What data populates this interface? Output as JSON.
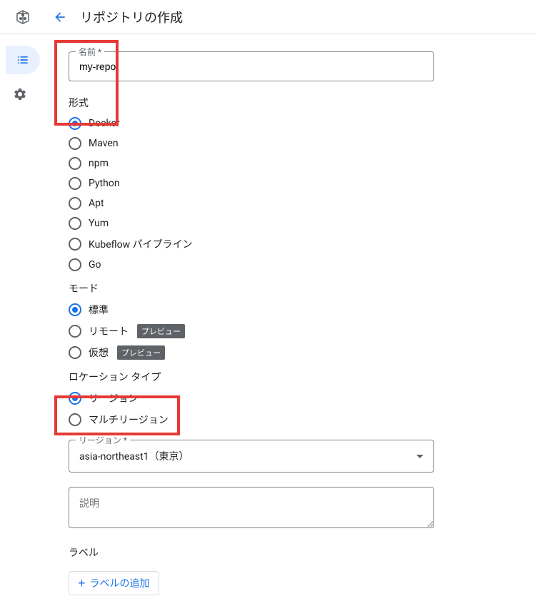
{
  "header": {
    "title": "リポジトリの作成"
  },
  "form": {
    "name": {
      "label": "名前 *",
      "value": "my-repo"
    },
    "format": {
      "label": "形式",
      "options": [
        {
          "label": "Docker",
          "checked": true
        },
        {
          "label": "Maven",
          "checked": false
        },
        {
          "label": "npm",
          "checked": false
        },
        {
          "label": "Python",
          "checked": false
        },
        {
          "label": "Apt",
          "checked": false
        },
        {
          "label": "Yum",
          "checked": false
        },
        {
          "label": "Kubeflow パイプライン",
          "checked": false
        },
        {
          "label": "Go",
          "checked": false
        }
      ]
    },
    "mode": {
      "label": "モード",
      "options": [
        {
          "label": "標準",
          "checked": true,
          "badge": null
        },
        {
          "label": "リモート",
          "checked": false,
          "badge": "プレビュー"
        },
        {
          "label": "仮想",
          "checked": false,
          "badge": "プレビュー"
        }
      ]
    },
    "locationType": {
      "label": "ロケーション タイプ",
      "options": [
        {
          "label": "リージョン",
          "checked": true
        },
        {
          "label": "マルチリージョン",
          "checked": false
        }
      ]
    },
    "region": {
      "label": "リージョン *",
      "value": "asia-northeast1（東京）"
    },
    "description": {
      "placeholder": "説明"
    },
    "labels": {
      "label": "ラベル",
      "addButton": "ラベルの追加"
    }
  }
}
